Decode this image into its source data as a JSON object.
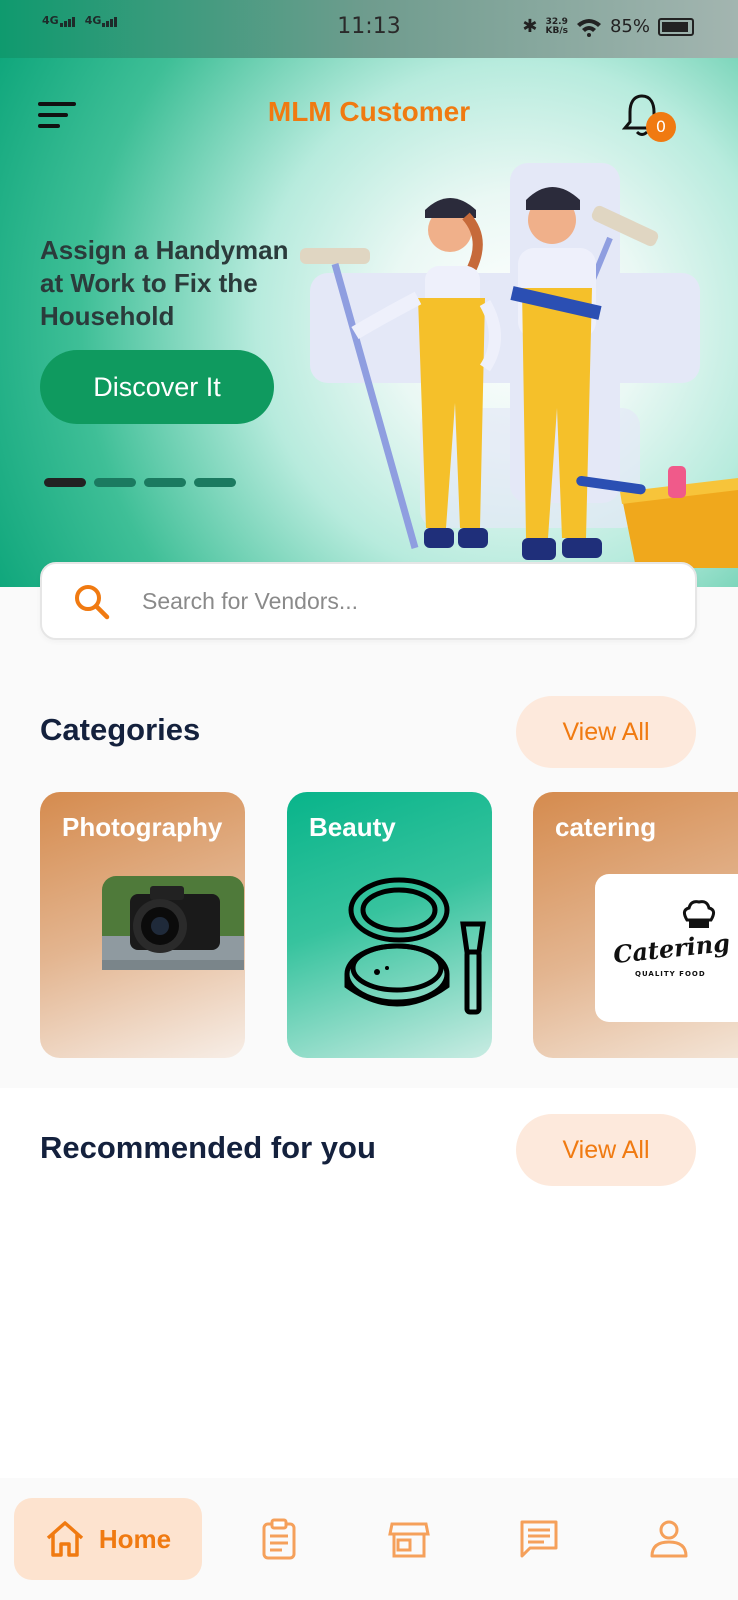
{
  "status_bar": {
    "network_1": "4G",
    "network_2": "4G",
    "time": "11:13",
    "speed_value": "32.9",
    "speed_unit": "KB/s",
    "battery": "85%"
  },
  "header": {
    "title": "MLM Customer",
    "notification_count": "0"
  },
  "banner": {
    "headline_line1": "Assign a Handyman",
    "headline_line2": "at Work to Fix the",
    "headline_line3": "Household",
    "cta_label": "Discover It",
    "slides_count": 4,
    "active_slide": 1
  },
  "search": {
    "placeholder": "Search for Vendors..."
  },
  "categories": {
    "title": "Categories",
    "view_all_label": "View All",
    "items": [
      {
        "label": "Photography"
      },
      {
        "label": "Beauty"
      },
      {
        "label": "catering"
      }
    ],
    "catering_logo_text": "Catering",
    "catering_logo_subtext": "QUALITY FOOD"
  },
  "recommended": {
    "title": "Recommended for you",
    "view_all_label": "View All"
  },
  "bottom_nav": {
    "home_label": "Home",
    "accent_color": "#f07a11",
    "items": [
      "home-icon",
      "orders-icon",
      "store-icon",
      "chat-icon",
      "profile-icon"
    ]
  },
  "colors": {
    "primary_green": "#0f9a5f",
    "accent_orange": "#f07a11",
    "title_navy": "#14213d"
  }
}
